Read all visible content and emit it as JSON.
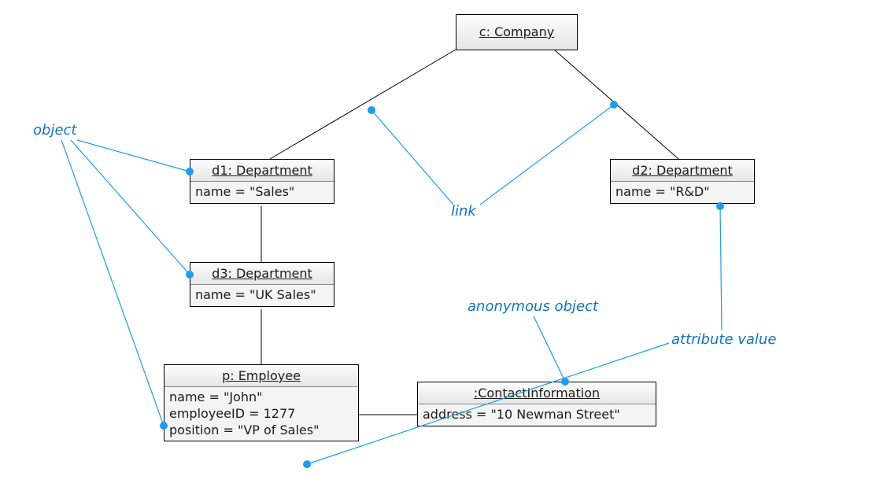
{
  "objects": {
    "company": {
      "title": "c: Company"
    },
    "d1": {
      "title": "d1: Department",
      "attrs": [
        "name = \"Sales\""
      ]
    },
    "d2": {
      "title": "d2: Department",
      "attrs": [
        "name = \"R&D\""
      ]
    },
    "d3": {
      "title": "d3: Department",
      "attrs": [
        "name = \"UK Sales\""
      ]
    },
    "employee": {
      "title": "p: Employee",
      "attrs": [
        "name = \"John\"",
        "employeeID = 1277",
        "position = \"VP of Sales\""
      ]
    },
    "contact": {
      "title": ":ContactInformation",
      "attrs": [
        "address = \"10 Newman Street\""
      ]
    }
  },
  "annotations": {
    "object_label": "object",
    "link_label": "link",
    "anonymous_object_label": "anonymous object",
    "attribute_value_label": "attribute value"
  },
  "chart_data": {
    "type": "object_diagram",
    "nodes": [
      {
        "id": "c",
        "name": "c",
        "class": "Company",
        "attributes": {}
      },
      {
        "id": "d1",
        "name": "d1",
        "class": "Department",
        "attributes": {
          "name": "Sales"
        }
      },
      {
        "id": "d2",
        "name": "d2",
        "class": "Department",
        "attributes": {
          "name": "R&D"
        }
      },
      {
        "id": "d3",
        "name": "d3",
        "class": "Department",
        "attributes": {
          "name": "UK Sales"
        }
      },
      {
        "id": "p",
        "name": "p",
        "class": "Employee",
        "attributes": {
          "name": "John",
          "employeeID": 1277,
          "position": "VP of Sales"
        }
      },
      {
        "id": "ci",
        "name": "",
        "class": "ContactInformation",
        "anonymous": true,
        "attributes": {
          "address": "10 Newman Street"
        }
      }
    ],
    "edges": [
      {
        "from": "c",
        "to": "d1"
      },
      {
        "from": "c",
        "to": "d2"
      },
      {
        "from": "d1",
        "to": "d3"
      },
      {
        "from": "d3",
        "to": "p"
      },
      {
        "from": "p",
        "to": "ci"
      }
    ],
    "callouts": [
      {
        "label": "object",
        "targets": [
          "d1",
          "d3",
          "p"
        ]
      },
      {
        "label": "link",
        "targets": [
          "edge c-d1",
          "edge c-d2"
        ]
      },
      {
        "label": "anonymous object",
        "targets": [
          "ci"
        ]
      },
      {
        "label": "attribute value",
        "targets": [
          "d2.name",
          "p.position"
        ]
      }
    ]
  }
}
